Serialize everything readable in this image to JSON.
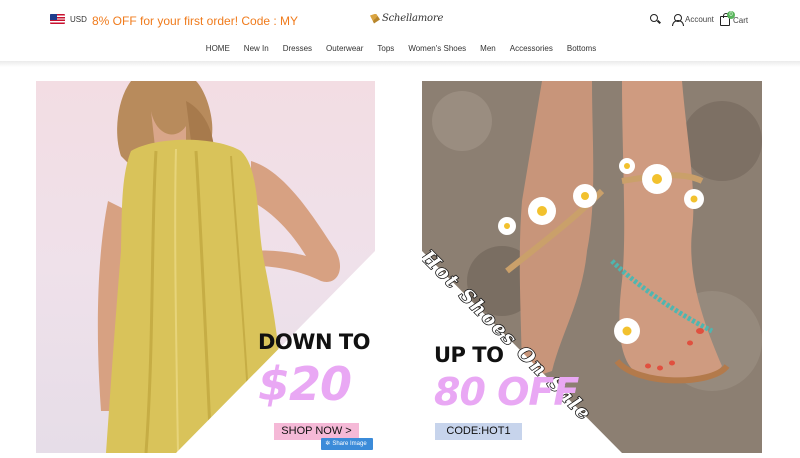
{
  "header": {
    "currency": "USD",
    "promo": "8% OFF for your first order! Code : MY",
    "logo": "Schellamore",
    "account_label": "Account",
    "cart_label": "Cart",
    "cart_count": "0"
  },
  "nav": {
    "items": [
      "HOME",
      "New In",
      "Dresses",
      "Outerwear",
      "Tops",
      "Women's Shoes",
      "Men",
      "Accessories",
      "Bottoms"
    ]
  },
  "banners": {
    "left": {
      "line1": "DOWN TO",
      "line2": "$20",
      "cta": "SHOP NOW >"
    },
    "right": {
      "script": "Hot Shoes On Sale",
      "line1": "UP TO",
      "line2": "80 OFF",
      "cta": "CODE:HOT1"
    },
    "share": "Share Image"
  },
  "colors": {
    "promo": "#f07b1c",
    "accent_pink": "#f5b9d7",
    "big_text": "#e9a8f4",
    "share_blue": "#3b8bd9",
    "cart_badge": "#58b55b"
  }
}
